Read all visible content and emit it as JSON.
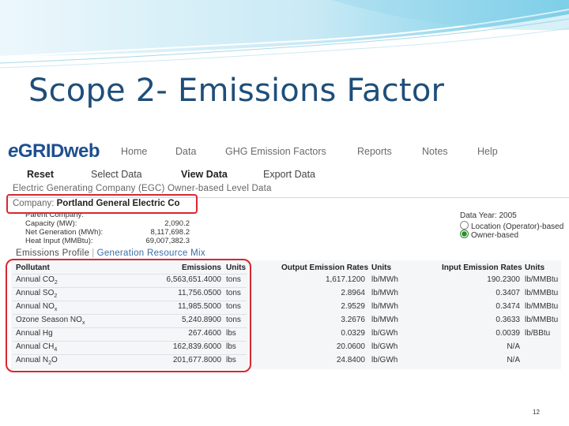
{
  "slide": {
    "title": "Scope 2- Emissions Factor",
    "page_number": "12"
  },
  "app": {
    "logo_prefix": "e",
    "logo_main": "GRID",
    "logo_suffix": "web"
  },
  "nav": {
    "items": [
      "Home",
      "Data",
      "GHG Emission Factors",
      "Reports",
      "Notes",
      "Help"
    ]
  },
  "subnav": {
    "reset": "Reset",
    "select": "Select Data",
    "view": "View Data",
    "export": "Export Data"
  },
  "section_title": "Electric Generating Company (EGC) Owner-based Level Data",
  "company": {
    "label": "Company:",
    "name": "Portland General Electric Co"
  },
  "info": {
    "parent_label": "Parent Company:",
    "rows": [
      {
        "label": "Capacity (MW):",
        "value": "2,090.2"
      },
      {
        "label": "Net Generation (MWh):",
        "value": "8,117,698.2"
      },
      {
        "label": "Heat Input (MMBtu):",
        "value": "69,007,382.3"
      }
    ]
  },
  "options": {
    "data_year": "Data Year: 2005",
    "radio_operator": "Location (Operator)-based",
    "radio_owner": "Owner-based",
    "selected": "Owner-based"
  },
  "tabs": {
    "profile": "Emissions Profile",
    "mix": "Generation Resource Mix"
  },
  "table": {
    "headers": {
      "pollutant": "Pollutant",
      "emissions": "Emissions",
      "units": "Units",
      "output_rates": "Output Emission Rates",
      "output_units": "Units",
      "input_rates": "Input Emission Rates",
      "input_units": "Units"
    },
    "rows": [
      {
        "pollutant": "Annual CO",
        "sub": "2",
        "emissions": "6,563,651.4000",
        "units": "tons",
        "out": "1,617.1200",
        "out_u": "lb/MWh",
        "in": "190.2300",
        "in_u": "lb/MMBtu"
      },
      {
        "pollutant": "Annual SO",
        "sub": "2",
        "emissions": "11,756.0500",
        "units": "tons",
        "out": "2.8964",
        "out_u": "lb/MWh",
        "in": "0.3407",
        "in_u": "lb/MMBtu"
      },
      {
        "pollutant": "Annual NO",
        "sub": "x",
        "emissions": "11,985.5000",
        "units": "tons",
        "out": "2.9529",
        "out_u": "lb/MWh",
        "in": "0.3474",
        "in_u": "lb/MMBtu"
      },
      {
        "pollutant": "Ozone Season NO",
        "sub": "x",
        "emissions": "5,240.8900",
        "units": "tons",
        "out": "3.2676",
        "out_u": "lb/MWh",
        "in": "0.3633",
        "in_u": "lb/MMBtu"
      },
      {
        "pollutant": "Annual Hg",
        "sub": "",
        "emissions": "267.4600",
        "units": "lbs",
        "out": "0.0329",
        "out_u": "lb/GWh",
        "in": "0.0039",
        "in_u": "lb/BBtu"
      },
      {
        "pollutant": "Annual CH",
        "sub": "4",
        "emissions": "162,839.6000",
        "units": "lbs",
        "out": "20.0600",
        "out_u": "lb/GWh",
        "in": "N/A",
        "in_u": ""
      },
      {
        "pollutant": "Annual N",
        "sub": "2",
        "pollutant_tail": "O",
        "emissions": "201,677.8000",
        "units": "lbs",
        "out": "24.8400",
        "out_u": "lb/GWh",
        "in": "N/A",
        "in_u": ""
      }
    ]
  },
  "colors": {
    "title": "#1f4e79",
    "highlight": "#d7282f",
    "logo": "#1e4f8f"
  }
}
